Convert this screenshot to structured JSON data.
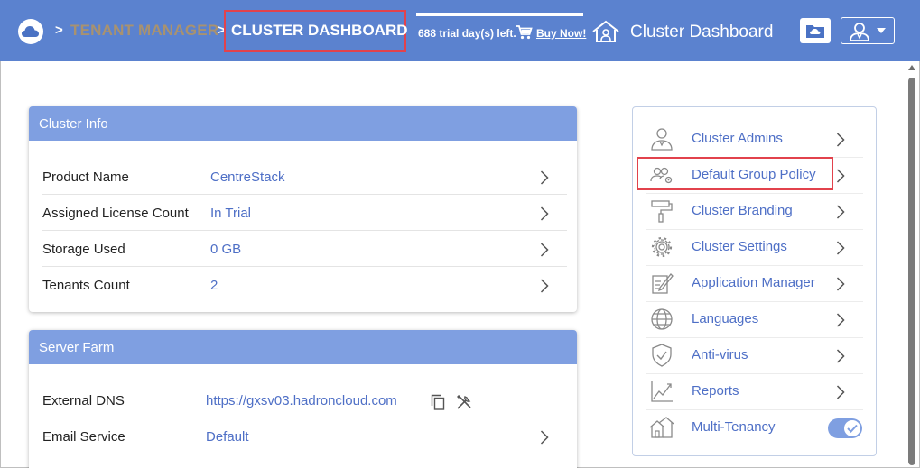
{
  "header": {
    "breadcrumb_sep": ">",
    "tenant_manager": "TENANT MANAGER",
    "current_page": "CLUSTER DASHBOARD",
    "trial_text": "688 trial day(s) left.",
    "buy_now": "Buy Now!",
    "title": "Cluster Dashboard"
  },
  "cluster_info": {
    "title": "Cluster Info",
    "rows": [
      {
        "label": "Product Name",
        "value": "CentreStack"
      },
      {
        "label": "Assigned License Count",
        "value": "In Trial"
      },
      {
        "label": "Storage Used",
        "value": "0 GB"
      },
      {
        "label": "Tenants Count",
        "value": "2"
      }
    ]
  },
  "server_farm": {
    "title": "Server Farm",
    "rows": [
      {
        "label": "External DNS",
        "value": "https://gxsv03.hadroncloud.com"
      },
      {
        "label": "Email Service",
        "value": "Default"
      }
    ]
  },
  "menu": {
    "items": [
      {
        "label": "Cluster Admins",
        "icon": "admin-user-icon"
      },
      {
        "label": "Default Group Policy",
        "icon": "group-policy-icon"
      },
      {
        "label": "Cluster Branding",
        "icon": "paint-roller-icon"
      },
      {
        "label": "Cluster Settings",
        "icon": "gear-icon"
      },
      {
        "label": "Application Manager",
        "icon": "edit-document-icon"
      },
      {
        "label": "Languages",
        "icon": "globe-icon"
      },
      {
        "label": "Anti-virus",
        "icon": "shield-check-icon"
      },
      {
        "label": "Reports",
        "icon": "line-chart-icon"
      },
      {
        "label": "Multi-Tenancy",
        "icon": "multi-house-icon",
        "toggle_on": true
      }
    ]
  },
  "colors": {
    "header_bg": "#5b82cf",
    "card_header_bg": "#7f9fe1",
    "link_blue": "#4e6fc6",
    "highlight_red": "#e2424c",
    "breadcrumb_gold": "#a89270"
  }
}
